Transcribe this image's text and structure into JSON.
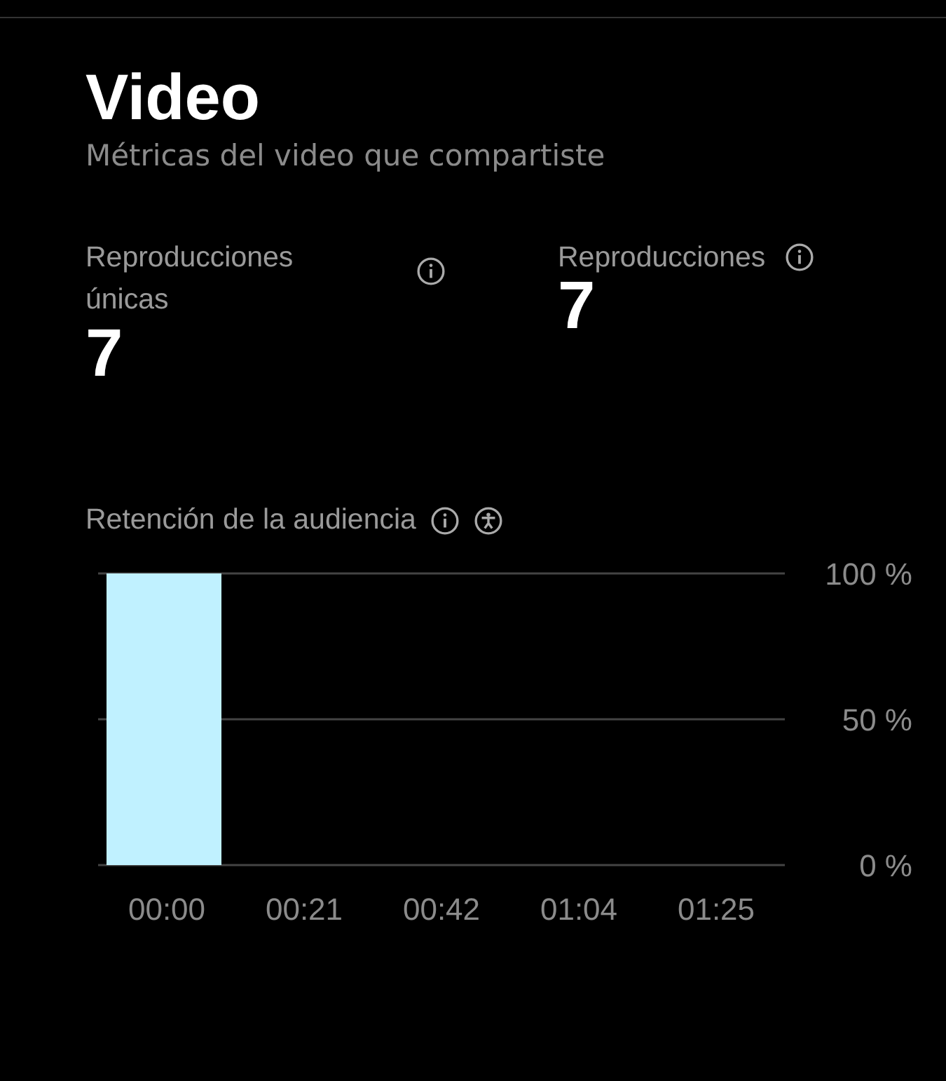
{
  "title": "Video",
  "subtitle": "Métricas del video que compartiste",
  "metrics": [
    {
      "label": "Reproducciones únicas",
      "value": "7"
    },
    {
      "label": "Reproducciones",
      "value": "7"
    }
  ],
  "retention": {
    "title": "Retención de la audiencia",
    "chart_data": {
      "type": "bar",
      "categories": [
        "00:00",
        "00:21",
        "00:42",
        "01:04",
        "01:25"
      ],
      "series": [
        {
          "color": "#c0f1ff",
          "values": [
            100,
            null,
            null,
            null,
            null
          ]
        }
      ],
      "ylim": [
        0,
        100
      ],
      "yticks": [
        {
          "value": 0,
          "label": "0 %"
        },
        {
          "value": 50,
          "label": "50 %"
        },
        {
          "value": 100,
          "label": "100 %"
        }
      ]
    }
  }
}
